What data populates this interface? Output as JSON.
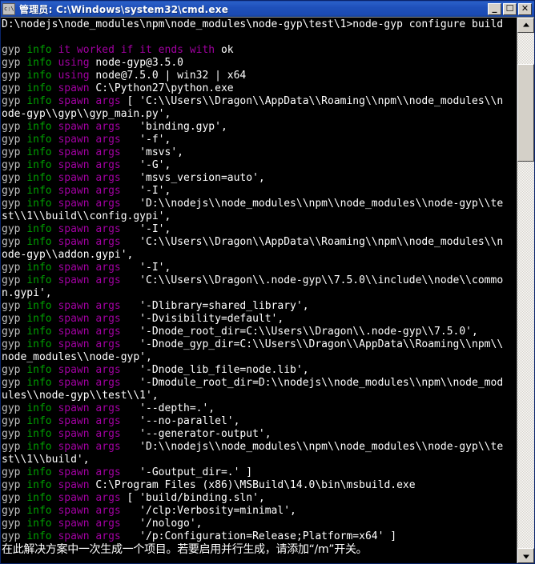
{
  "window": {
    "title": "管理员: C:\\Windows\\system32\\cmd.exe",
    "sysmenu_icon": "cmd-icon",
    "controls": {
      "minimize_label": "_",
      "maximize_label": "☐",
      "close_label": "✕"
    }
  },
  "scrollbar": {
    "up_arrow": "▲",
    "down_arrow": "▼",
    "thumb_top_pct": 6,
    "thumb_height_pct": 19
  },
  "console": {
    "columns": 80,
    "colors": {
      "background": "#000000",
      "default_text": "#c0c0c0",
      "bright_white": "#ffffff",
      "green": "#00a000",
      "magenta": "#a000a0"
    },
    "lines": [
      {
        "segments": [
          {
            "text": "D:\\nodejs\\node_modules\\npm\\node_modules\\node-gyp\\test\\1>node-gyp configure build",
            "color": "bwhite"
          }
        ]
      },
      {
        "segments": [
          {
            "text": "",
            "color": "white"
          }
        ]
      },
      {
        "segments": [
          {
            "text": "gyp ",
            "color": "gray"
          },
          {
            "text": "info ",
            "color": "green"
          },
          {
            "text": "it worked if it ends with ",
            "color": "magenta"
          },
          {
            "text": "ok",
            "color": "bwhite"
          }
        ]
      },
      {
        "segments": [
          {
            "text": "gyp ",
            "color": "gray"
          },
          {
            "text": "info ",
            "color": "green"
          },
          {
            "text": "using ",
            "color": "magenta"
          },
          {
            "text": "node-gyp@3.5.0",
            "color": "bwhite"
          }
        ]
      },
      {
        "segments": [
          {
            "text": "gyp ",
            "color": "gray"
          },
          {
            "text": "info ",
            "color": "green"
          },
          {
            "text": "using ",
            "color": "magenta"
          },
          {
            "text": "node@7.5.0 | win32 | x64",
            "color": "bwhite"
          }
        ]
      },
      {
        "segments": [
          {
            "text": "gyp ",
            "color": "gray"
          },
          {
            "text": "info ",
            "color": "green"
          },
          {
            "text": "spawn ",
            "color": "magenta"
          },
          {
            "text": "C:\\Python27\\python.exe",
            "color": "bwhite"
          }
        ]
      },
      {
        "segments": [
          {
            "text": "gyp ",
            "color": "gray"
          },
          {
            "text": "info ",
            "color": "green"
          },
          {
            "text": "spawn args ",
            "color": "magenta"
          },
          {
            "text": "[ 'C:\\\\Users\\\\Dragon\\\\AppData\\\\Roaming\\\\npm\\\\node_modules\\\\n",
            "color": "bwhite"
          }
        ]
      },
      {
        "segments": [
          {
            "text": "ode-gyp\\\\gyp\\\\gyp_main.py',",
            "color": "bwhite"
          }
        ]
      },
      {
        "segments": [
          {
            "text": "gyp ",
            "color": "gray"
          },
          {
            "text": "info ",
            "color": "green"
          },
          {
            "text": "spawn args ",
            "color": "magenta"
          },
          {
            "text": "  'binding.gyp',",
            "color": "bwhite"
          }
        ]
      },
      {
        "segments": [
          {
            "text": "gyp ",
            "color": "gray"
          },
          {
            "text": "info ",
            "color": "green"
          },
          {
            "text": "spawn args ",
            "color": "magenta"
          },
          {
            "text": "  '-f',",
            "color": "bwhite"
          }
        ]
      },
      {
        "segments": [
          {
            "text": "gyp ",
            "color": "gray"
          },
          {
            "text": "info ",
            "color": "green"
          },
          {
            "text": "spawn args ",
            "color": "magenta"
          },
          {
            "text": "  'msvs',",
            "color": "bwhite"
          }
        ]
      },
      {
        "segments": [
          {
            "text": "gyp ",
            "color": "gray"
          },
          {
            "text": "info ",
            "color": "green"
          },
          {
            "text": "spawn args ",
            "color": "magenta"
          },
          {
            "text": "  '-G',",
            "color": "bwhite"
          }
        ]
      },
      {
        "segments": [
          {
            "text": "gyp ",
            "color": "gray"
          },
          {
            "text": "info ",
            "color": "green"
          },
          {
            "text": "spawn args ",
            "color": "magenta"
          },
          {
            "text": "  'msvs_version=auto',",
            "color": "bwhite"
          }
        ]
      },
      {
        "segments": [
          {
            "text": "gyp ",
            "color": "gray"
          },
          {
            "text": "info ",
            "color": "green"
          },
          {
            "text": "spawn args ",
            "color": "magenta"
          },
          {
            "text": "  '-I',",
            "color": "bwhite"
          }
        ]
      },
      {
        "segments": [
          {
            "text": "gyp ",
            "color": "gray"
          },
          {
            "text": "info ",
            "color": "green"
          },
          {
            "text": "spawn args ",
            "color": "magenta"
          },
          {
            "text": "  'D:\\\\nodejs\\\\node_modules\\\\npm\\\\node_modules\\\\node-gyp\\\\te",
            "color": "bwhite"
          }
        ]
      },
      {
        "segments": [
          {
            "text": "st\\\\1\\\\build\\\\config.gypi',",
            "color": "bwhite"
          }
        ]
      },
      {
        "segments": [
          {
            "text": "gyp ",
            "color": "gray"
          },
          {
            "text": "info ",
            "color": "green"
          },
          {
            "text": "spawn args ",
            "color": "magenta"
          },
          {
            "text": "  '-I',",
            "color": "bwhite"
          }
        ]
      },
      {
        "segments": [
          {
            "text": "gyp ",
            "color": "gray"
          },
          {
            "text": "info ",
            "color": "green"
          },
          {
            "text": "spawn args ",
            "color": "magenta"
          },
          {
            "text": "  'C:\\\\Users\\\\Dragon\\\\AppData\\\\Roaming\\\\npm\\\\node_modules\\\\n",
            "color": "bwhite"
          }
        ]
      },
      {
        "segments": [
          {
            "text": "ode-gyp\\\\addon.gypi',",
            "color": "bwhite"
          }
        ]
      },
      {
        "segments": [
          {
            "text": "gyp ",
            "color": "gray"
          },
          {
            "text": "info ",
            "color": "green"
          },
          {
            "text": "spawn args ",
            "color": "magenta"
          },
          {
            "text": "  '-I',",
            "color": "bwhite"
          }
        ]
      },
      {
        "segments": [
          {
            "text": "gyp ",
            "color": "gray"
          },
          {
            "text": "info ",
            "color": "green"
          },
          {
            "text": "spawn args ",
            "color": "magenta"
          },
          {
            "text": "  'C:\\\\Users\\\\Dragon\\\\.node-gyp\\\\7.5.0\\\\include\\\\node\\\\commo",
            "color": "bwhite"
          }
        ]
      },
      {
        "segments": [
          {
            "text": "n.gypi',",
            "color": "bwhite"
          }
        ]
      },
      {
        "segments": [
          {
            "text": "gyp ",
            "color": "gray"
          },
          {
            "text": "info ",
            "color": "green"
          },
          {
            "text": "spawn args ",
            "color": "magenta"
          },
          {
            "text": "  '-Dlibrary=shared_library',",
            "color": "bwhite"
          }
        ]
      },
      {
        "segments": [
          {
            "text": "gyp ",
            "color": "gray"
          },
          {
            "text": "info ",
            "color": "green"
          },
          {
            "text": "spawn args ",
            "color": "magenta"
          },
          {
            "text": "  '-Dvisibility=default',",
            "color": "bwhite"
          }
        ]
      },
      {
        "segments": [
          {
            "text": "gyp ",
            "color": "gray"
          },
          {
            "text": "info ",
            "color": "green"
          },
          {
            "text": "spawn args ",
            "color": "magenta"
          },
          {
            "text": "  '-Dnode_root_dir=C:\\\\Users\\\\Dragon\\\\.node-gyp\\\\7.5.0',",
            "color": "bwhite"
          }
        ]
      },
      {
        "segments": [
          {
            "text": "gyp ",
            "color": "gray"
          },
          {
            "text": "info ",
            "color": "green"
          },
          {
            "text": "spawn args ",
            "color": "magenta"
          },
          {
            "text": "  '-Dnode_gyp_dir=C:\\\\Users\\\\Dragon\\\\AppData\\\\Roaming\\\\npm\\\\",
            "color": "bwhite"
          }
        ]
      },
      {
        "segments": [
          {
            "text": "node_modules\\\\node-gyp',",
            "color": "bwhite"
          }
        ]
      },
      {
        "segments": [
          {
            "text": "gyp ",
            "color": "gray"
          },
          {
            "text": "info ",
            "color": "green"
          },
          {
            "text": "spawn args ",
            "color": "magenta"
          },
          {
            "text": "  '-Dnode_lib_file=node.lib',",
            "color": "bwhite"
          }
        ]
      },
      {
        "segments": [
          {
            "text": "gyp ",
            "color": "gray"
          },
          {
            "text": "info ",
            "color": "green"
          },
          {
            "text": "spawn args ",
            "color": "magenta"
          },
          {
            "text": "  '-Dmodule_root_dir=D:\\\\nodejs\\\\node_modules\\\\npm\\\\node_mod",
            "color": "bwhite"
          }
        ]
      },
      {
        "segments": [
          {
            "text": "ules\\\\node-gyp\\\\test\\\\1',",
            "color": "bwhite"
          }
        ]
      },
      {
        "segments": [
          {
            "text": "gyp ",
            "color": "gray"
          },
          {
            "text": "info ",
            "color": "green"
          },
          {
            "text": "spawn args ",
            "color": "magenta"
          },
          {
            "text": "  '--depth=.',",
            "color": "bwhite"
          }
        ]
      },
      {
        "segments": [
          {
            "text": "gyp ",
            "color": "gray"
          },
          {
            "text": "info ",
            "color": "green"
          },
          {
            "text": "spawn args ",
            "color": "magenta"
          },
          {
            "text": "  '--no-parallel',",
            "color": "bwhite"
          }
        ]
      },
      {
        "segments": [
          {
            "text": "gyp ",
            "color": "gray"
          },
          {
            "text": "info ",
            "color": "green"
          },
          {
            "text": "spawn args ",
            "color": "magenta"
          },
          {
            "text": "  '--generator-output',",
            "color": "bwhite"
          }
        ]
      },
      {
        "segments": [
          {
            "text": "gyp ",
            "color": "gray"
          },
          {
            "text": "info ",
            "color": "green"
          },
          {
            "text": "spawn args ",
            "color": "magenta"
          },
          {
            "text": "  'D:\\\\nodejs\\\\node_modules\\\\npm\\\\node_modules\\\\node-gyp\\\\te",
            "color": "bwhite"
          }
        ]
      },
      {
        "segments": [
          {
            "text": "st\\\\1\\\\build',",
            "color": "bwhite"
          }
        ]
      },
      {
        "segments": [
          {
            "text": "gyp ",
            "color": "gray"
          },
          {
            "text": "info ",
            "color": "green"
          },
          {
            "text": "spawn args ",
            "color": "magenta"
          },
          {
            "text": "  '-Goutput_dir=.' ]",
            "color": "bwhite"
          }
        ]
      },
      {
        "segments": [
          {
            "text": "gyp ",
            "color": "gray"
          },
          {
            "text": "info ",
            "color": "green"
          },
          {
            "text": "spawn ",
            "color": "magenta"
          },
          {
            "text": "C:\\Program Files (x86)\\MSBuild\\14.0\\bin\\msbuild.exe",
            "color": "bwhite"
          }
        ]
      },
      {
        "segments": [
          {
            "text": "gyp ",
            "color": "gray"
          },
          {
            "text": "info ",
            "color": "green"
          },
          {
            "text": "spawn args ",
            "color": "magenta"
          },
          {
            "text": "[ 'build/binding.sln',",
            "color": "bwhite"
          }
        ]
      },
      {
        "segments": [
          {
            "text": "gyp ",
            "color": "gray"
          },
          {
            "text": "info ",
            "color": "green"
          },
          {
            "text": "spawn args ",
            "color": "magenta"
          },
          {
            "text": "  '/clp:Verbosity=minimal',",
            "color": "bwhite"
          }
        ]
      },
      {
        "segments": [
          {
            "text": "gyp ",
            "color": "gray"
          },
          {
            "text": "info ",
            "color": "green"
          },
          {
            "text": "spawn args ",
            "color": "magenta"
          },
          {
            "text": "  '/nologo',",
            "color": "bwhite"
          }
        ]
      },
      {
        "segments": [
          {
            "text": "gyp ",
            "color": "gray"
          },
          {
            "text": "info ",
            "color": "green"
          },
          {
            "text": "spawn args ",
            "color": "magenta"
          },
          {
            "text": "  '/p:Configuration=Release;Platform=x64' ]",
            "color": "bwhite"
          }
        ]
      },
      {
        "cjk": true,
        "segments": [
          {
            "text": "在此解决方案中一次生成一个项目。若要启用并行生成，请添加“/m”开关。",
            "color": "cn"
          }
        ]
      }
    ]
  }
}
